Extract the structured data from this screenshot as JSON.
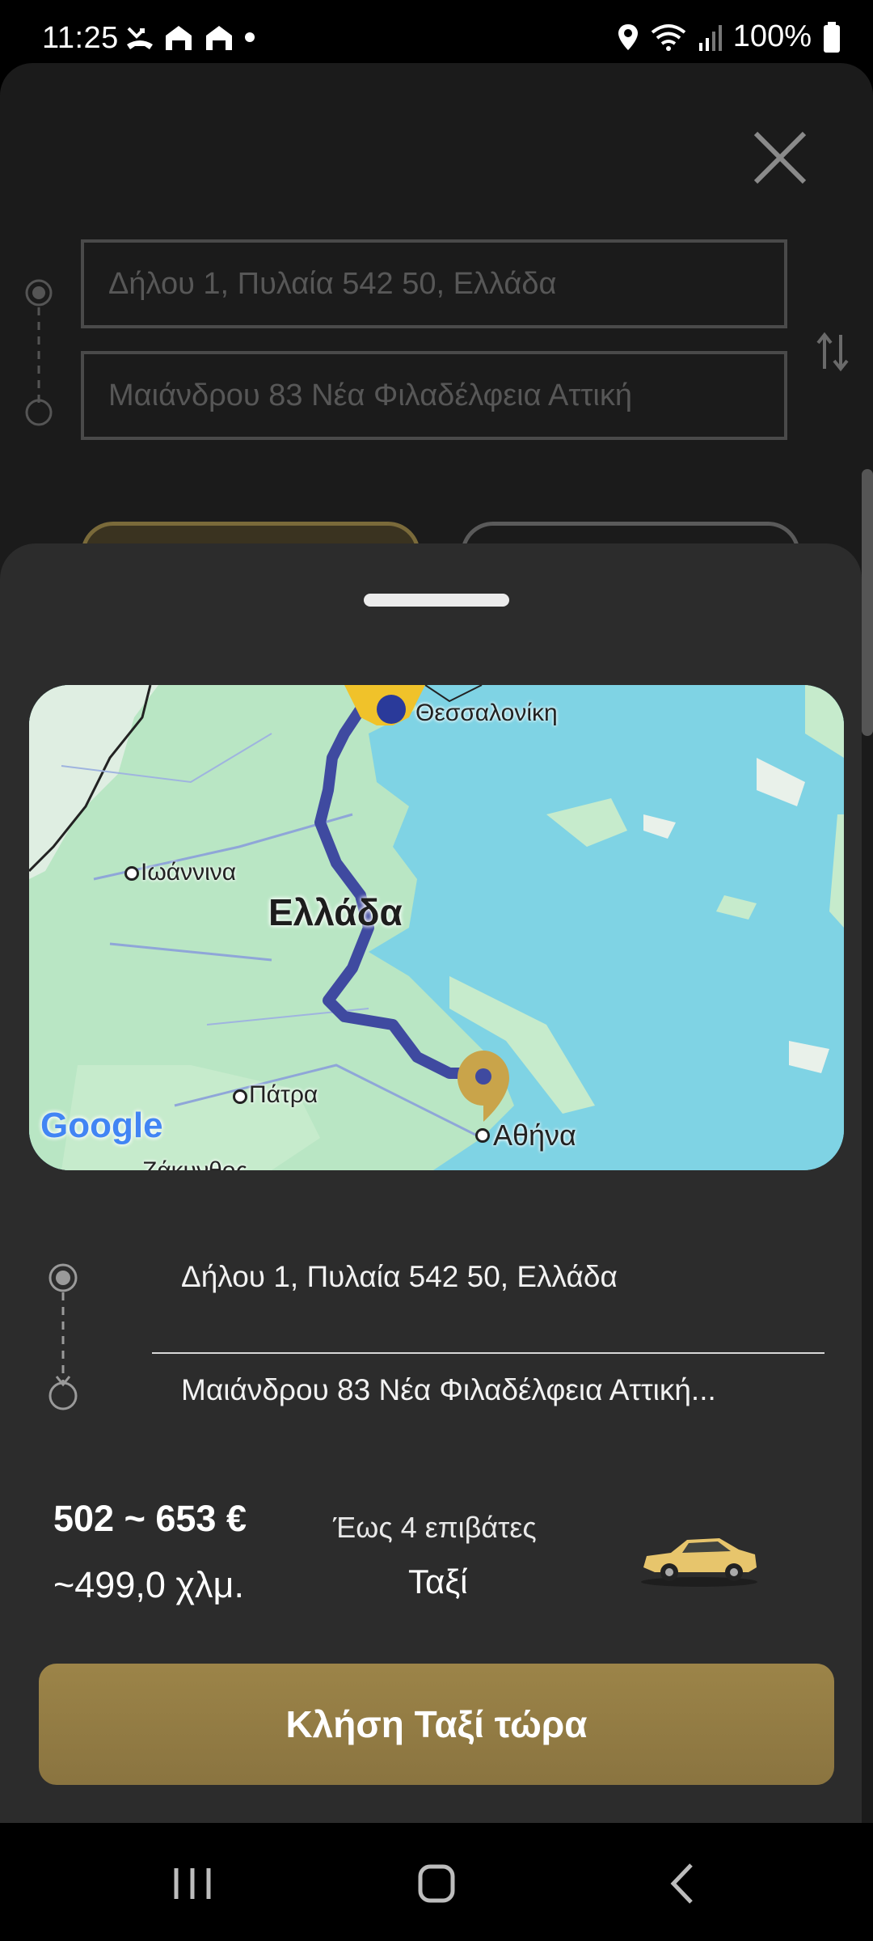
{
  "status_bar": {
    "time": "11:25",
    "battery": "100%",
    "left_icons": [
      "missed-call-icon",
      "home-icon",
      "home-icon",
      "dot-icon"
    ],
    "right_icons": [
      "location-icon",
      "wifi-icon",
      "signal-icon",
      "battery-icon"
    ]
  },
  "background": {
    "pickup_field": "Δήλου 1, Πυλαία 542 50, Ελλάδα",
    "dropoff_field": "Μαιάνδρου 83  Νέα Φιλαδέλφεια Αττική"
  },
  "map": {
    "country_label": "Ελλάδα",
    "cities": {
      "thessaloniki": "Θεσσαλονίκη",
      "ioannina": "Ιωάννινα",
      "patra": "Πάτρα",
      "athina": "Αθήνα",
      "zakynthos": "Ζάκυνθος"
    },
    "attribution": "Google",
    "colors": {
      "water": "#7fd3e4",
      "land": "#b9e6c4",
      "route": "#3f4aa0",
      "pin": "#c9a44a"
    }
  },
  "route": {
    "pickup": "Δήλου 1, Πυλαία 542 50, Ελλάδα",
    "dropoff": "Μαιάνδρου 83  Νέα Φιλαδέλφεια Αττική..."
  },
  "trip": {
    "price": "502 ~ 653 €",
    "distance": "~499,0 χλμ.",
    "passengers": "Έως 4 επιβάτες",
    "vehicle_type": "Ταξί"
  },
  "actions": {
    "call_button": "Κλήση Ταξί τώρα"
  },
  "colors": {
    "accent": "#9c8448",
    "sheet": "#2c2c2c"
  }
}
